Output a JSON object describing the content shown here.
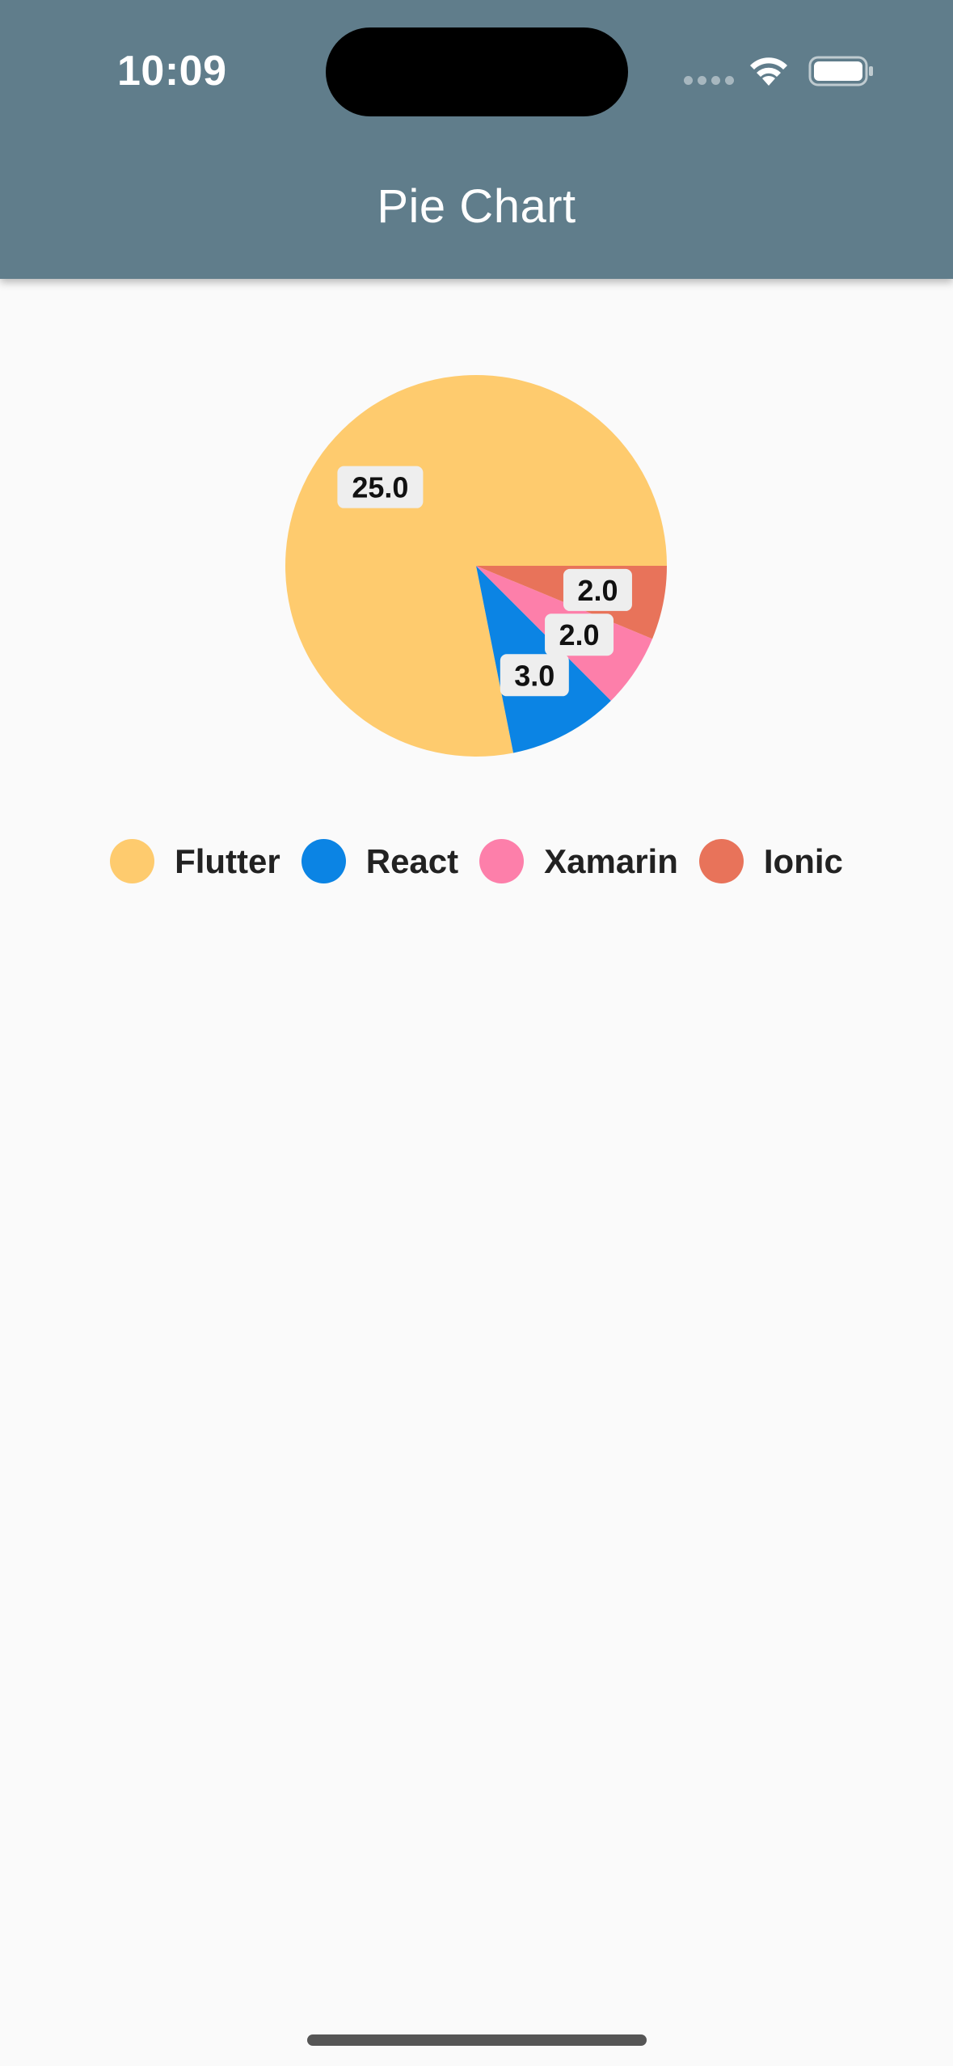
{
  "status_bar": {
    "time": "10:09"
  },
  "app_bar": {
    "title": "Pie Chart",
    "color": "#607d8b"
  },
  "chart_data": {
    "type": "pie",
    "categories": [
      "Flutter",
      "React",
      "Xamarin",
      "Ionic"
    ],
    "values": [
      25.0,
      3.0,
      2.0,
      2.0
    ],
    "data_labels": [
      "25.0",
      "3.0",
      "2.0",
      "2.0"
    ],
    "colors": [
      "#fecb6e",
      "#0b84e4",
      "#fd7faa",
      "#e8735a"
    ],
    "legend_position": "bottom",
    "start_angle": "3 o'clock",
    "direction": "counter-clockwise"
  }
}
